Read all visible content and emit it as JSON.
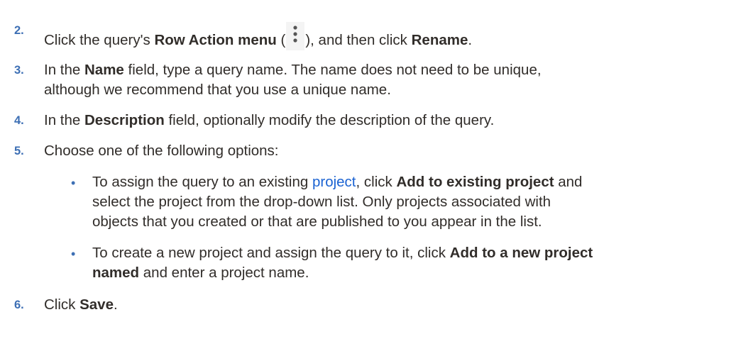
{
  "steps": [
    {
      "number": "2.",
      "parts": {
        "a": "Click the query's ",
        "b": "Row Action menu",
        "c": " (",
        "d": "), and then click ",
        "e": "Rename",
        "f": "."
      }
    },
    {
      "number": "3.",
      "line1": {
        "a": "In the ",
        "b": "Name",
        "c": " field, type a query name. The name does not need to be unique,"
      },
      "line2": "although we recommend that you use a unique name."
    },
    {
      "number": "4.",
      "parts": {
        "a": "In the ",
        "b": "Description",
        "c": " field, optionally modify the description of the query."
      }
    },
    {
      "number": "5.",
      "text": "Choose one of the following options:"
    },
    {
      "number": "6.",
      "parts": {
        "a": "Click ",
        "b": "Save",
        "c": "."
      }
    }
  ],
  "bullets": [
    {
      "marker": "•",
      "line1": {
        "a": "To assign the query to an existing ",
        "link": "project",
        "b": ", click ",
        "c": "Add to existing project",
        "d": " and"
      },
      "line2": "select the project from the drop-down list. Only projects associated with",
      "line3": "objects that you created or that are published to you appear in the list."
    },
    {
      "marker": "•",
      "line1": {
        "a": "To create a new project and assign the query to it, click ",
        "b": "Add to a new project"
      },
      "line2": {
        "a": "named",
        "b": " and enter a project name."
      }
    }
  ],
  "icons": {
    "row_action": "kebab-vertical-icon"
  },
  "colors": {
    "step_number": "#3d6fb4",
    "link": "#1b63d2",
    "text": "#312d2a"
  }
}
